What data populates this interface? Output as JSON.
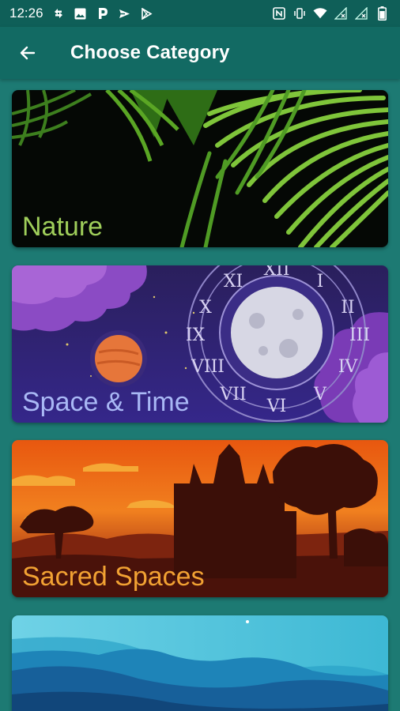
{
  "status_bar": {
    "time": "12:26",
    "left_icons": [
      "sync-icon",
      "image-icon",
      "pandora-icon",
      "send-icon",
      "play-store-icon"
    ],
    "right_icons": [
      "nfc-icon",
      "vibrate-icon",
      "wifi-icon",
      "no-signal-icon",
      "no-signal-icon",
      "battery-icon"
    ]
  },
  "app_bar": {
    "title": "Choose Category",
    "back_icon": "arrow-left-icon"
  },
  "categories": [
    {
      "label": "Nature",
      "label_color": "#9fce5a"
    },
    {
      "label": "Space & Time",
      "label_color": "#a9b8f5"
    },
    {
      "label": "Sacred Spaces",
      "label_color": "#f2a233"
    },
    {
      "label": "",
      "label_color": "#ffffff"
    }
  ],
  "colors": {
    "background": "#1d7a73",
    "app_bar": "#126a63",
    "status_bar": "#0f5f58"
  }
}
